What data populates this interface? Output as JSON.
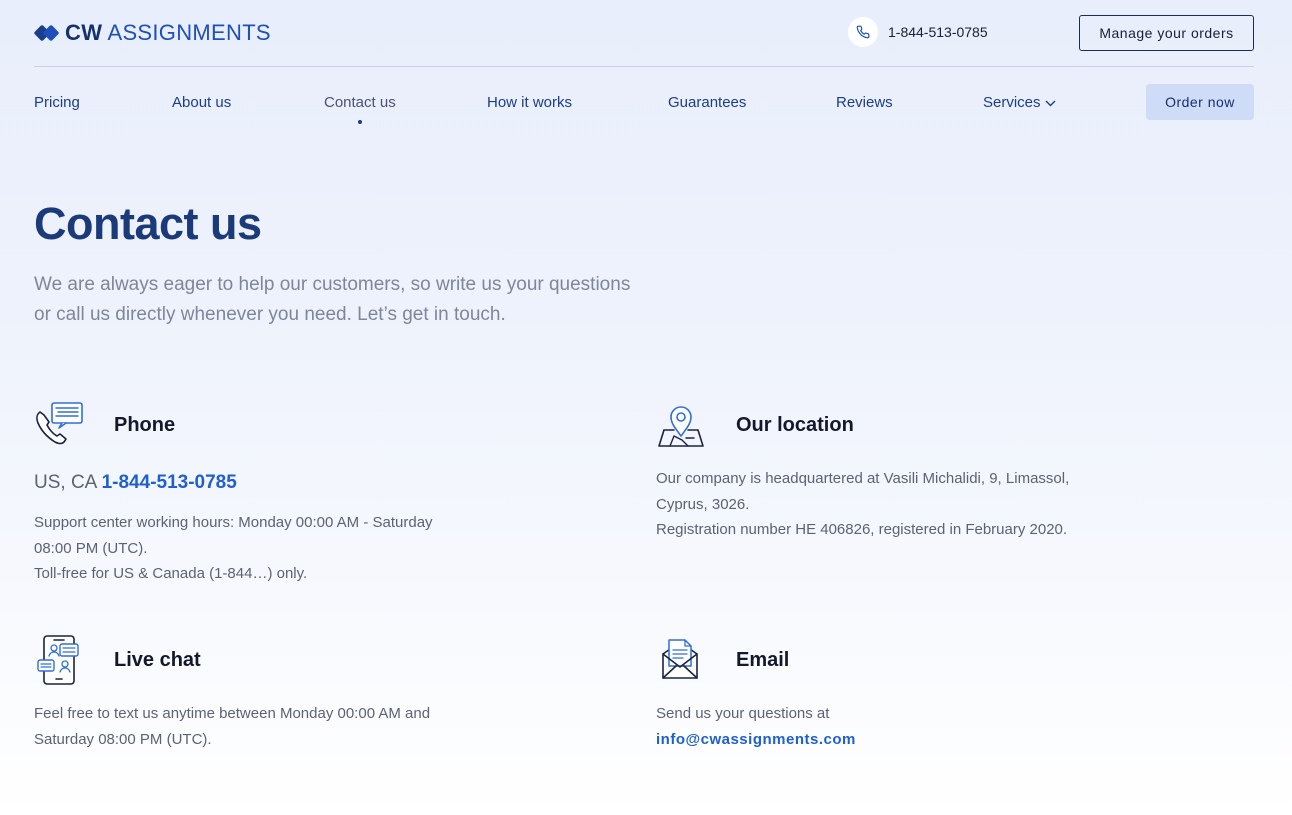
{
  "header": {
    "logo_bold": "CW",
    "logo_light": "ASSIGNMENTS",
    "phone": "1-844-513-0785",
    "manage_label": "Manage your orders"
  },
  "nav": {
    "items": [
      {
        "label": "Pricing"
      },
      {
        "label": "About us"
      },
      {
        "label": "Contact us"
      },
      {
        "label": "How it works"
      },
      {
        "label": "Guarantees"
      },
      {
        "label": "Reviews"
      },
      {
        "label": "Services"
      }
    ],
    "order_label": "Order now"
  },
  "main": {
    "title": "Contact us",
    "subtitle": "We are always eager to help our customers, so write us your questions or call us directly whenever you need. Let’s get in touch."
  },
  "phone_block": {
    "heading": "Phone",
    "region": "US, CA",
    "number": "1-844-513-0785",
    "hours": "Support center working hours: Monday 00:00 AM - Saturday 08:00 PM (UTC).",
    "tollfree": "Toll-free for US & Canada (1-844…) only."
  },
  "location_block": {
    "heading": "Our location",
    "address": "Our company is headquartered at Vasili Michalidi, 9, Limassol, Cyprus, 3026.",
    "registration": "Registration number HE 406826, registered in February 2020."
  },
  "chat_block": {
    "heading": "Live chat",
    "text": "Feel free to text us anytime between Monday 00:00 AM and Saturday 08:00 PM (UTC)."
  },
  "email_block": {
    "heading": "Email",
    "text": "Send us your questions at",
    "address": "info@cwassignments.com"
  },
  "icons": {
    "logo": "diamond-logo-icon",
    "phone": "phone-icon",
    "chevron": "chevron-down-icon",
    "phone_chat": "phone-chat-icon",
    "location": "location-pin-map-icon",
    "live_chat": "mobile-chat-icon",
    "email": "envelope-document-icon"
  },
  "colors": {
    "brand": "#1b3d8a",
    "link": "#1f5fd0",
    "order_button_bg": "#cfdcf7"
  }
}
